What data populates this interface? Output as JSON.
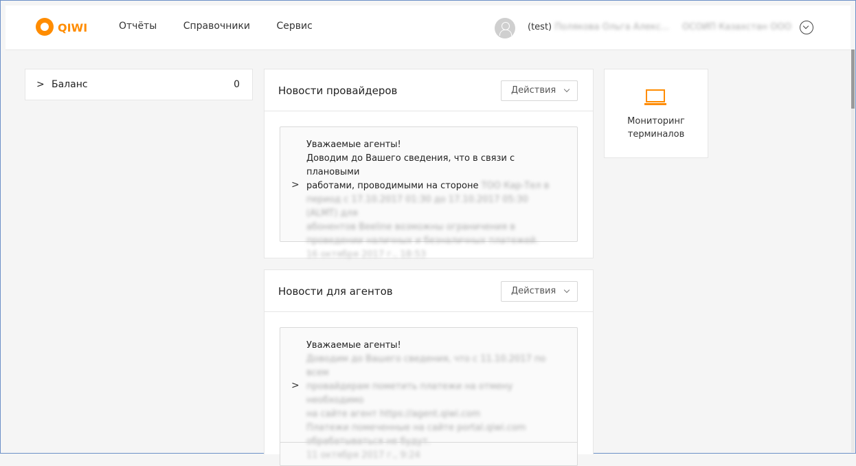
{
  "header": {
    "logo_text": "QIWI",
    "nav": [
      "Отчёты",
      "Справочники",
      "Сервис"
    ],
    "user_prefix": "(test)",
    "user_name": "Полякова Ольга Алекс...",
    "organization": "ОСОИП Казахстан ООО"
  },
  "sidebar": {
    "balance_label": "Баланс",
    "balance_value": "0"
  },
  "cards": [
    {
      "title": "Новости провайдеров",
      "actions_label": "Действия",
      "news": {
        "lines": [
          "Уважаемые агенты!",
          "Доводим до Вашего сведения, что в связи с плановыми",
          "работами, проводимыми на стороне",
          "период с 17.10.2017 01:30 до 17.10.2017 05:30 (ALMT) для",
          "абонентов Beeline возможны ограничения в",
          "проведении наличных и безналичных платежей."
        ],
        "blurred_inline": "TOO Кар-Тел в",
        "date": "16 октября 2017 г., 18:53"
      }
    },
    {
      "title": "Новости для агентов",
      "actions_label": "Действия",
      "news": {
        "lines": [
          "Уважаемые агенты!",
          "Доводим до Вашего сведения, что с 11.10.2017 по всем",
          "провайдерам пометить платежи на отмену необходимо",
          "на сайте агент https://agent.qiwi.com",
          "Платежи помеченные на сайте portal.qiwi.com",
          "обрабатываться не будут."
        ],
        "date": "11 октября 2017 г., 9:24"
      }
    }
  ],
  "widgets": {
    "monitoring_line1": "Мониторинг",
    "monitoring_line2": "терминалов"
  },
  "colors": {
    "brand": "#ff8c00",
    "border": "#e6e6e6"
  },
  "icons": [
    "chevron-right-icon",
    "chevron-down-icon",
    "avatar-icon",
    "laptop-icon",
    "circle-chevron-down-icon"
  ]
}
